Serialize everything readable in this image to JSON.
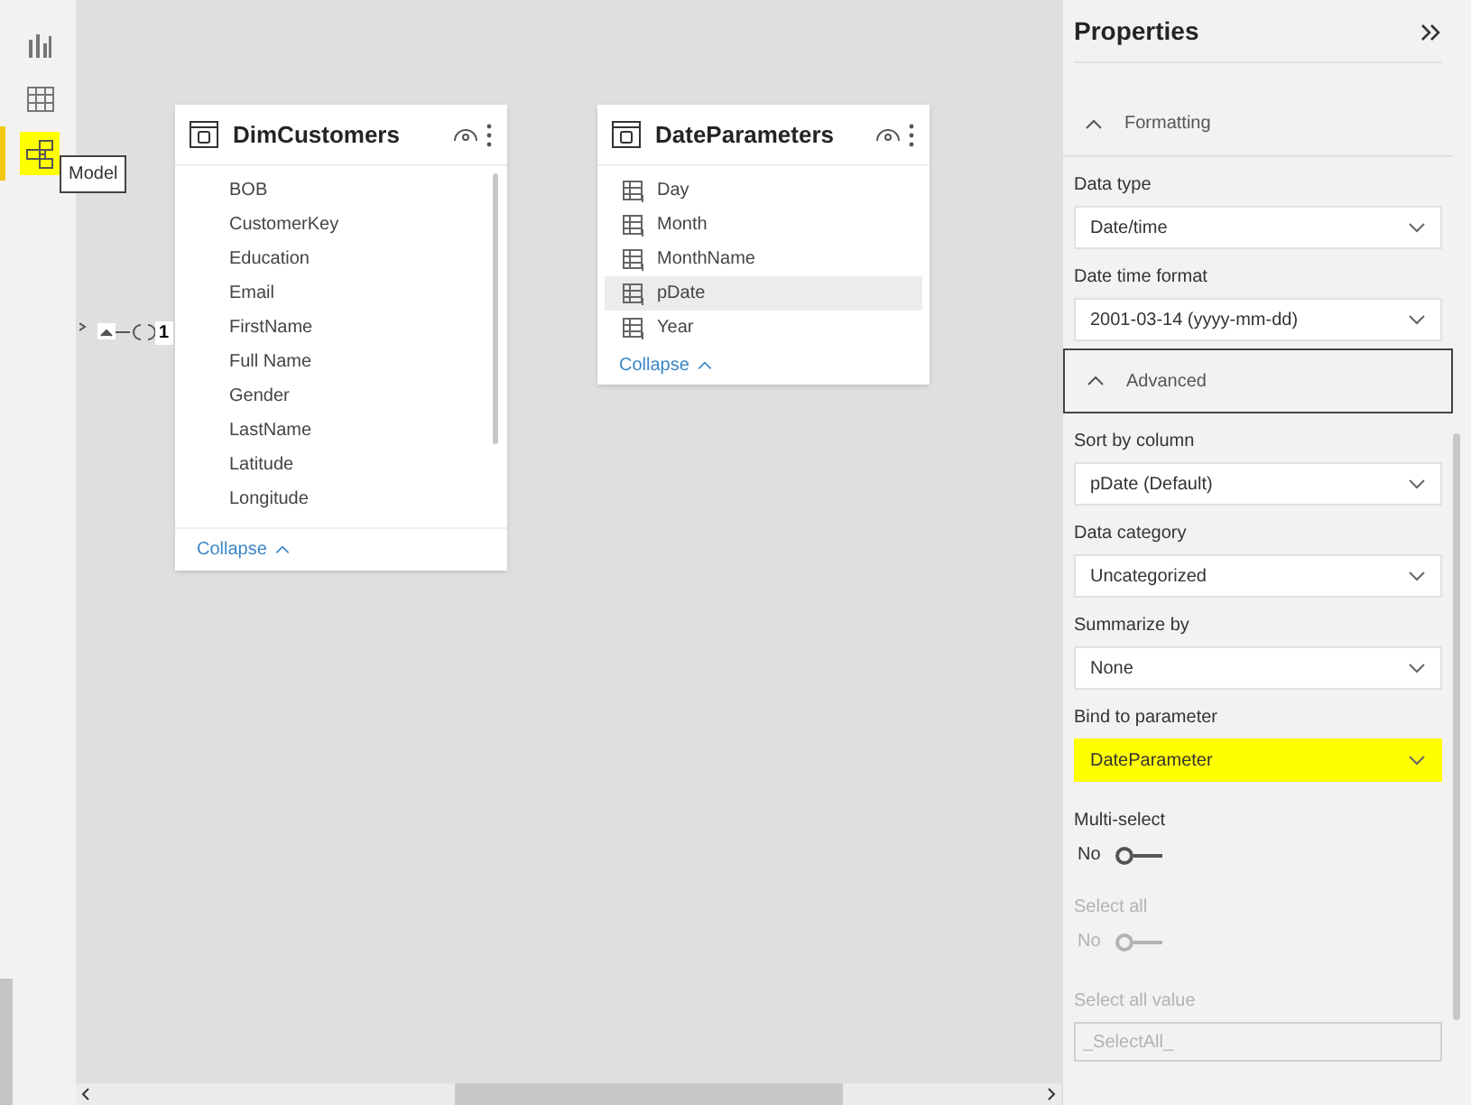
{
  "nav": [
    {
      "kind": "report",
      "selected": false
    },
    {
      "kind": "data",
      "selected": false
    },
    {
      "kind": "model",
      "selected": true,
      "highlighted": true
    }
  ],
  "tooltip": "Model",
  "relationship": {
    "cardinality": "1"
  },
  "tables": [
    {
      "name": "DimCustomers",
      "show_field_icons": false,
      "scrollable": true,
      "columns": [
        {
          "name": "BOB",
          "selected": false
        },
        {
          "name": "CustomerKey",
          "selected": false
        },
        {
          "name": "Education",
          "selected": false
        },
        {
          "name": "Email",
          "selected": false
        },
        {
          "name": "FirstName",
          "selected": false
        },
        {
          "name": "Full Name",
          "selected": false
        },
        {
          "name": "Gender",
          "selected": false
        },
        {
          "name": "LastName",
          "selected": false
        },
        {
          "name": "Latitude",
          "selected": false
        },
        {
          "name": "Longitude",
          "selected": false
        }
      ],
      "collapse": "Collapse"
    },
    {
      "name": "DateParameters",
      "show_field_icons": true,
      "scrollable": false,
      "columns": [
        {
          "name": "Day",
          "selected": false
        },
        {
          "name": "Month",
          "selected": false
        },
        {
          "name": "MonthName",
          "selected": false
        },
        {
          "name": "pDate",
          "selected": true
        },
        {
          "name": "Year",
          "selected": false
        }
      ],
      "collapse": "Collapse"
    }
  ],
  "properties": {
    "title": "Properties",
    "items": [
      {
        "kind": "section",
        "label": "Formatting",
        "expanded": true,
        "focused": false
      },
      {
        "kind": "dropdown",
        "label": "Data type",
        "value": "Date/time",
        "highlighted": false
      },
      {
        "kind": "dropdown",
        "label": "Date time format",
        "value": "2001-03-14 (yyyy-mm-dd)",
        "highlighted": false
      },
      {
        "kind": "section",
        "label": "Advanced",
        "expanded": true,
        "focused": true
      },
      {
        "kind": "dropdown",
        "label": "Sort by column",
        "value": "pDate (Default)",
        "highlighted": false
      },
      {
        "kind": "dropdown",
        "label": "Data category",
        "value": "Uncategorized",
        "highlighted": false
      },
      {
        "kind": "dropdown",
        "label": "Summarize by",
        "value": "None",
        "highlighted": false
      },
      {
        "kind": "dropdown",
        "label": "Bind to parameter",
        "value": "DateParameter",
        "highlighted": true
      },
      {
        "kind": "toggle",
        "label": "Multi-select",
        "value": "No",
        "on": false,
        "disabled": false
      },
      {
        "kind": "toggle",
        "label": "Select all",
        "value": "No",
        "on": false,
        "disabled": true
      },
      {
        "kind": "text_field",
        "label": "Select all value",
        "placeholder": "_SelectAll_",
        "disabled": true
      }
    ]
  }
}
